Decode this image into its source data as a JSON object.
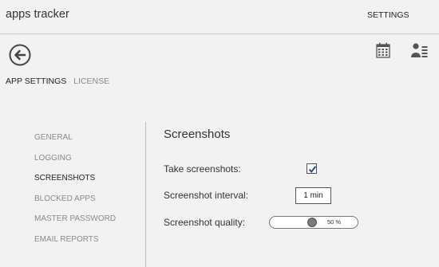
{
  "app": {
    "title": "apps tracker",
    "settings_label": "SETTINGS"
  },
  "tabs": [
    {
      "label": "APP SETTINGS",
      "active": true
    },
    {
      "label": "LICENSE",
      "active": false
    }
  ],
  "nav": {
    "items": [
      {
        "label": "GENERAL",
        "selected": false
      },
      {
        "label": "LOGGING",
        "selected": false
      },
      {
        "label": "SCREENSHOTS",
        "selected": true
      },
      {
        "label": "BLOCKED APPS",
        "selected": false
      },
      {
        "label": "MASTER PASSWORD",
        "selected": false
      },
      {
        "label": "EMAIL REPORTS",
        "selected": false
      }
    ]
  },
  "screenshots": {
    "title": "Screenshots",
    "take_label": "Take screenshots:",
    "take_checked": true,
    "interval_label": "Screenshot interval:",
    "interval_value": "1 min",
    "quality_label": "Screenshot quality:",
    "quality_text": "50 %",
    "quality_value": 0.5
  },
  "icons": {
    "back": "back-arrow-icon",
    "calendar": "calendar-icon",
    "user_list": "user-list-icon"
  },
  "colors": {
    "background": "#f2f2f2",
    "divider": "#bdbdbd",
    "nav_inactive": "#8a8a8a",
    "text": "#333333"
  }
}
